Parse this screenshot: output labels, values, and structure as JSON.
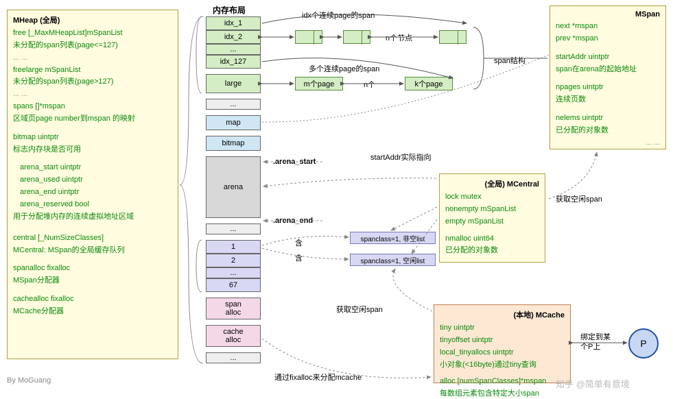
{
  "headers": {
    "layout": "内存布局"
  },
  "mheap": {
    "title": "MHeap (全局)",
    "free": "free      [_MaxMHeapList]mSpanList",
    "free_desc": "未分配的span列表(page<=127)",
    "dots1": "... ...",
    "freelarge": "freelarge mSpanList",
    "freelarge_desc": "未分配的span列表(page>127)",
    "dots2": "... ...",
    "spans": "spans []*mspan",
    "spans_desc": "区域页page number到mspan 的映射",
    "bitmap": "bitmap         uintptr",
    "bitmap_desc": "标志内存块是否可用",
    "a1": "arena_start     uintptr",
    "a2": "arena_used     uintptr",
    "a3": "arena_end       uintptr",
    "a4": "arena_reserved bool",
    "arena_desc": "用于分配堆内存的连续虚拟地址区域",
    "central": "central [_NumSizeClasses]",
    "central_desc": "MCentral: MSpan的全局缓存队列",
    "spanalloc": "spanalloc          fixalloc",
    "spanalloc_desc": "MSpan分配器",
    "cachealloc": "cachealloc         fixalloc",
    "cachealloc_desc": "MCache分配器"
  },
  "mspan": {
    "title": "MSpan",
    "next": "next *mspan",
    "prev": "prev *mspan",
    "startAddr": "startAddr uintptr",
    "startAddr_desc": "span在arena的起始地址",
    "npages": "npages  uintptr",
    "npages_desc": "连续页数",
    "nelems": "nelems uintptr",
    "nelems_desc": "已分配的对象数",
    "dots": "... ..."
  },
  "mcentral": {
    "title": "(全局) MCentral",
    "lock": "lock       mutex",
    "nonempty": "nonempty  mSpanList",
    "empty": "empty  mSpanList",
    "nmalloc": "nmalloc uint64",
    "nmalloc_desc": "已分配的对象数"
  },
  "mcache": {
    "title": "(本地) MCache",
    "tiny": "tiny                       uintptr",
    "tinyoffset": "tinyoffset              uintptr",
    "local": "local_tinyallocs uintptr",
    "local_desc": "小对象(<16byte)通过tiny查询",
    "alloc": "alloc [numSpanClasses]*mspan",
    "alloc_desc": "每数组元素包含特定大小span"
  },
  "mem": {
    "idx1": "idx_1",
    "idx2": "idx_2",
    "idxdots": "...",
    "idx127": "idx_127",
    "large": "large",
    "dots": "...",
    "map": "map",
    "bitmap": "bitmap",
    "arena": "arena",
    "n1": "1",
    "n2": "2",
    "ndots": "...",
    "n67": "67",
    "spanalloc": "span\nalloc",
    "cachealloc": "cache\nalloc",
    "enddots": "..."
  },
  "labels": {
    "span_idx": "idx个连续page的span",
    "n_nodes": "n个节点",
    "span_multi": "多个连续page的span",
    "m_page": "m个page",
    "n_arrow": "n个",
    "k_page": "k个page",
    "span_struct": "span结构",
    "arena_start": ".arena_start",
    "arena_end": ".arena_end",
    "startaddr_point": "startAddr实际指向",
    "contain": "含",
    "sc_nonempty": "spanclass=1, 非空list",
    "sc_empty": "spanclass=1, 空闲list",
    "get_span": "获取空闲span",
    "get_span2": "获取空闲span",
    "bind_p": "绑定到某\n个P上",
    "via_fixalloc": "通过fixalloc来分配mcache",
    "p": "P"
  },
  "byline": "By MoGuang",
  "watermark": "知乎 @简单有意境"
}
